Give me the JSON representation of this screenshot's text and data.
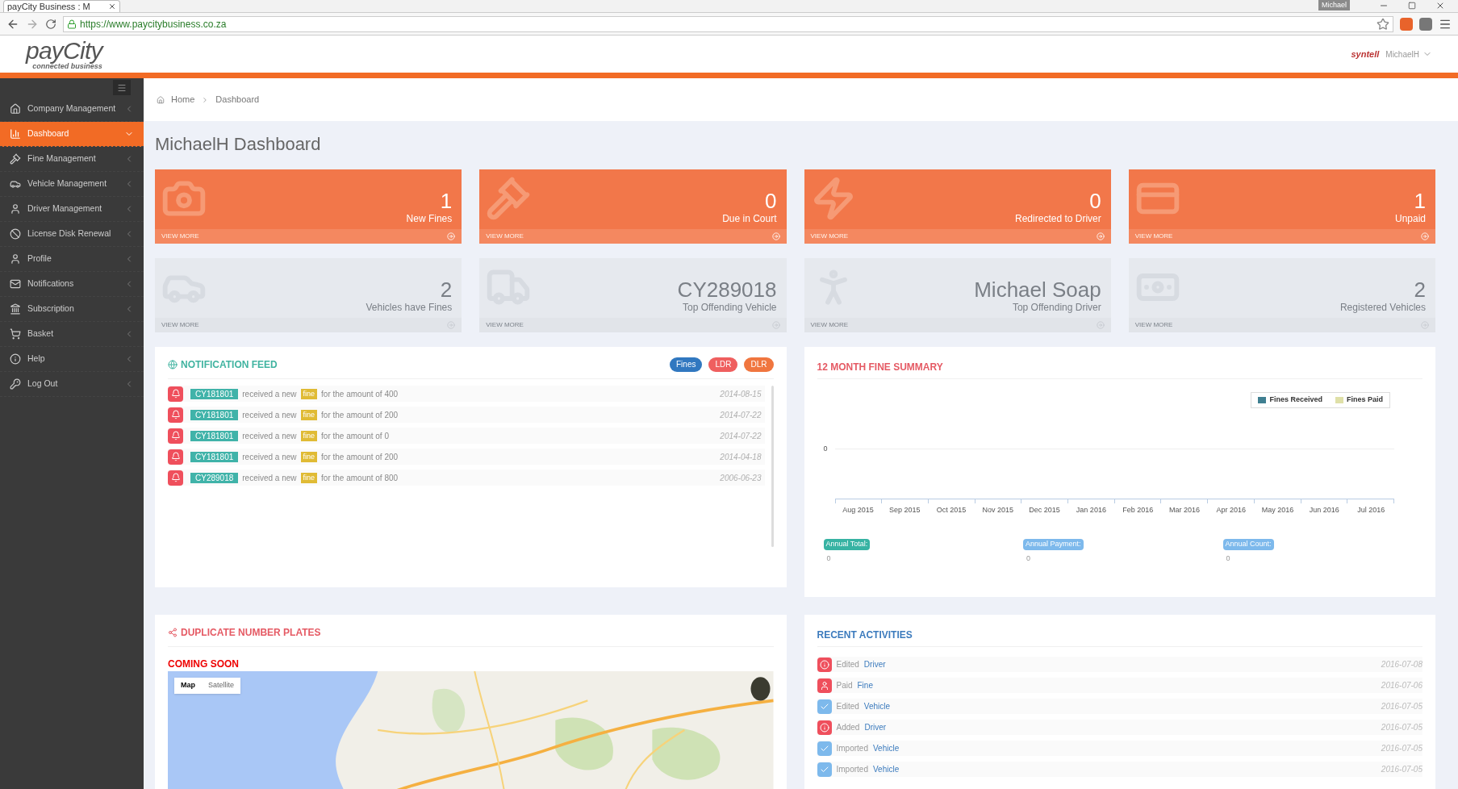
{
  "browser": {
    "tab_title": "payCity Business : M",
    "url": "https://www.paycitybusiness.co.za",
    "profile": "Michael"
  },
  "header": {
    "logo": "payCity",
    "logo_tagline": "connected business",
    "partner_logo": "syntell",
    "user": "MichaelH"
  },
  "sidebar": {
    "items": [
      {
        "label": "Company Management",
        "selected": false
      },
      {
        "label": "Dashboard",
        "selected": true
      },
      {
        "label": "Fine Management",
        "selected": false
      },
      {
        "label": "Vehicle Management",
        "selected": false
      },
      {
        "label": "Driver Management",
        "selected": false
      },
      {
        "label": "License Disk Renewal",
        "selected": false
      },
      {
        "label": "Profile",
        "selected": false
      },
      {
        "label": "Notifications",
        "selected": false
      },
      {
        "label": "Subscription",
        "selected": false
      },
      {
        "label": "Basket",
        "selected": false
      },
      {
        "label": "Help",
        "selected": false
      },
      {
        "label": "Log Out",
        "selected": false
      }
    ]
  },
  "breadcrumb": [
    "Home",
    "Dashboard"
  ],
  "page_title": "MichaelH Dashboard",
  "stat_cards": [
    {
      "kind": "alert",
      "value": "1",
      "label": "New Fines",
      "link": "VIEW MORE"
    },
    {
      "kind": "alert",
      "value": "0",
      "label": "Due in Court",
      "link": "VIEW MORE"
    },
    {
      "kind": "alert",
      "value": "0",
      "label": "Redirected to Driver",
      "link": "VIEW MORE"
    },
    {
      "kind": "alert",
      "value": "1",
      "label": "Unpaid",
      "link": "VIEW MORE"
    },
    {
      "kind": "info",
      "value": "2",
      "label": "Vehicles have Fines",
      "link": "VIEW MORE"
    },
    {
      "kind": "info",
      "value": "CY289018",
      "label": "Top Offending Vehicle",
      "link": "VIEW MORE"
    },
    {
      "kind": "info",
      "value": "Michael Soap",
      "label": "Top Offending Driver",
      "link": "VIEW MORE"
    },
    {
      "kind": "info",
      "value": "2",
      "label": "Registered Vehicles",
      "link": "VIEW MORE"
    }
  ],
  "notification_feed": {
    "title": "NOTIFICATION FEED",
    "filters": [
      {
        "label": "Fines",
        "color": "#3178c0"
      },
      {
        "label": "LDR",
        "color": "#ef5f5f"
      },
      {
        "label": "DLR",
        "color": "#f0763f"
      }
    ],
    "items": [
      {
        "plate": "CY181801",
        "text_before": "received a new",
        "tag": "fine",
        "text_after": "for the amount of 400",
        "date": "2014-08-15"
      },
      {
        "plate": "CY181801",
        "text_before": "received a new",
        "tag": "fine",
        "text_after": "for the amount of 200",
        "date": "2014-07-22"
      },
      {
        "plate": "CY181801",
        "text_before": "received a new",
        "tag": "fine",
        "text_after": "for the amount of 0",
        "date": "2014-07-22"
      },
      {
        "plate": "CY181801",
        "text_before": "received a new",
        "tag": "fine",
        "text_after": "for the amount of 200",
        "date": "2014-04-18"
      },
      {
        "plate": "CY289018",
        "text_before": "received a new",
        "tag": "fine",
        "text_after": "for the amount of 800",
        "date": "2006-06-23"
      }
    ]
  },
  "fine_summary": {
    "title": "12 MONTH FINE SUMMARY",
    "y_axis_label": "0",
    "months": [
      "Aug 2015",
      "Sep 2015",
      "Oct 2015",
      "Nov 2015",
      "Dec 2015",
      "Jan 2016",
      "Feb 2016",
      "Mar 2016",
      "Apr 2016",
      "May 2016",
      "Jun 2016",
      "Jul 2016"
    ],
    "legend": [
      {
        "name": "Fines Received",
        "color": "#3f7f91"
      },
      {
        "name": "Fines Paid",
        "color": "#dfe0a8"
      }
    ],
    "totals": [
      {
        "label": "Annual Total:",
        "value": "0",
        "color": "#37b3a3"
      },
      {
        "label": "Annual Payment:",
        "value": "0",
        "color": "#7db9ec"
      },
      {
        "label": "Annual Count:",
        "value": "0",
        "color": "#7db9ec"
      }
    ]
  },
  "duplicate_plates": {
    "title": "DUPLICATE NUMBER PLATES",
    "notice": "COMING SOON",
    "map_types": [
      {
        "label": "Map",
        "selected": true
      },
      {
        "label": "Satellite",
        "selected": false
      }
    ]
  },
  "recent_activities": {
    "title": "RECENT ACTIVITIES",
    "items": [
      {
        "kind": "info",
        "verb": "Edited",
        "object": "Driver",
        "date": "2016-07-08"
      },
      {
        "kind": "payment",
        "verb": "Paid",
        "object": "Fine",
        "date": "2016-07-06"
      },
      {
        "kind": "check",
        "verb": "Edited",
        "object": "Vehicle",
        "date": "2016-07-05"
      },
      {
        "kind": "info",
        "verb": "Added",
        "object": "Driver",
        "date": "2016-07-05"
      },
      {
        "kind": "check",
        "verb": "Imported",
        "object": "Vehicle",
        "date": "2016-07-05"
      },
      {
        "kind": "check",
        "verb": "Imported",
        "object": "Vehicle",
        "date": "2016-07-05"
      }
    ]
  }
}
